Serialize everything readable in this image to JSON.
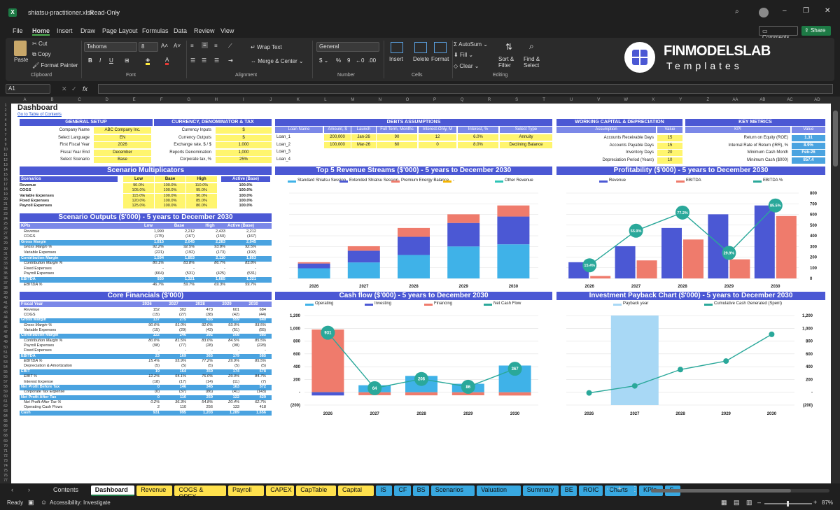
{
  "window": {
    "filename": "shiatsu-practitioner.xlsx",
    "mode": "Read-Only"
  },
  "menu": [
    "File",
    "Home",
    "Insert",
    "Draw",
    "Page Layout",
    "Formulas",
    "Data",
    "Review",
    "View"
  ],
  "top_buttons": {
    "comments": "Comments",
    "share": "Share"
  },
  "ribbon": {
    "paste": "Paste",
    "cut": "Cut",
    "copy": "Copy",
    "format_painter": "Format Painter",
    "clipboard": "Clipboard",
    "font_name": "Tahoma",
    "font_size": "8",
    "font": "Font",
    "wrap_text": "Wrap Text",
    "merge_center": "Merge & Center",
    "alignment": "Alignment",
    "number_format": "General",
    "number": "Number",
    "insert": "Insert",
    "delete": "Delete",
    "format": "Format",
    "cells": "Cells",
    "autosum": "AutoSum",
    "fill": "Fill",
    "clear": "Clear",
    "sort_filter": "Sort & Filter",
    "find_select": "Find & Select",
    "editing": "Editing"
  },
  "brand": {
    "name": "FINMODELSLAB",
    "sub": "Templates"
  },
  "formula_bar": {
    "cell_ref": "A1",
    "fx": "fx"
  },
  "columns": [
    "A",
    "B",
    "C",
    "D",
    "E",
    "F",
    "G",
    "H",
    "I",
    "J",
    "K",
    "L",
    "M",
    "N",
    "O",
    "P",
    "Q",
    "R",
    "S",
    "T",
    "U",
    "V",
    "W",
    "X",
    "Y",
    "Z",
    "AA",
    "AB",
    "AC",
    "AD"
  ],
  "rows": [
    "1",
    "2",
    "3",
    "4",
    "5",
    "6",
    "7",
    "8",
    "9",
    "10",
    "11",
    "12",
    "13",
    "14",
    "15",
    "16",
    "17",
    "18",
    "19",
    "20",
    "21",
    "22",
    "23",
    "24",
    "25",
    "26",
    "27",
    "28",
    "29",
    "30",
    "31",
    "32",
    "33",
    "34",
    "35",
    "36",
    "37",
    "38",
    "39",
    "40",
    "41",
    "42",
    "43",
    "44",
    "45",
    "46",
    "47",
    "48",
    "49",
    "50",
    "51",
    "52",
    "53",
    "54",
    "55",
    "56",
    "57",
    "58",
    "59",
    "60",
    "61",
    "62",
    "63",
    "64",
    "65",
    "66",
    "67",
    "68",
    "69",
    "70",
    "71",
    "72",
    "73",
    "74",
    "75",
    "76",
    "77"
  ],
  "dashboard": {
    "title": "Dashboard",
    "toc_link": "Go to Table of Contents"
  },
  "general_setup": {
    "title": "GENERAL SETUP",
    "rows": [
      [
        "Company Name",
        "ABC Company Inc."
      ],
      [
        "Select Language",
        "EN"
      ],
      [
        "First Fiscal Year",
        "2026"
      ],
      [
        "Fiscal Year End",
        "December"
      ],
      [
        "Select Scenario",
        "Base"
      ]
    ]
  },
  "currency": {
    "title": "CURRENCY, DENOMINATOR & TAX",
    "rows": [
      [
        "Currency Inputs",
        "$"
      ],
      [
        "Currency Outputs",
        "$"
      ],
      [
        "Exchange rate, $ / $",
        "1.000"
      ],
      [
        "Reports Denomination",
        "1,000"
      ],
      [
        "Corporate tax, %",
        "25%"
      ]
    ]
  },
  "debts": {
    "title": "DEBTS ASSUMPTIONS",
    "headers": [
      "Loan Name",
      "Amount, $",
      "Launch",
      "Full Term, Months",
      "Interest-Only, M",
      "Interest, %",
      "Select Type"
    ],
    "rows": [
      [
        "Loan_1",
        "200,000",
        "Jan-26",
        "90",
        "12",
        "6.0%",
        "Annuity"
      ],
      [
        "Loan_2",
        "100,000",
        "Mar-26",
        "60",
        "0",
        "8.0%",
        "Declining Balance"
      ],
      [
        "Loan_3",
        "",
        "",
        "",
        "",
        "",
        ""
      ],
      [
        "Loan_4",
        "",
        "",
        "",
        "",
        "",
        ""
      ]
    ]
  },
  "working_capital": {
    "title": "WORKING CAPITAL & DEPRECIATION",
    "headers": [
      "Assumption",
      "Value"
    ],
    "rows": [
      [
        "Accounts Receivable Days",
        "15"
      ],
      [
        "Accounts Payable Days",
        "15"
      ],
      [
        "Inventory Days",
        "20"
      ],
      [
        "Depreciation Period (Years)",
        "10"
      ]
    ]
  },
  "key_metrics": {
    "title": "KEY METRICS",
    "headers": [
      "KPI",
      "Value"
    ],
    "rows": [
      [
        "Return on Equity (ROE)",
        "1.31"
      ],
      [
        "Internal Rate of Return (IRR), %",
        "8.9%"
      ],
      [
        "Minimum Cash Month",
        "Feb-26"
      ],
      [
        "Minimum Cash ($000)",
        "857.4"
      ]
    ]
  },
  "scenario_mult": {
    "title": "Scenario Multiplicators",
    "headers": [
      "Scenarios",
      "Low",
      "Base",
      "High",
      "Active (Base)"
    ],
    "rows": [
      [
        "Revenue",
        "90.0%",
        "100.0%",
        "110.0%",
        "100.0%"
      ],
      [
        "COGS",
        "105.0%",
        "100.0%",
        "95.0%",
        "100.0%"
      ],
      [
        "Variable Expenses",
        "115.0%",
        "100.0%",
        "90.0%",
        "100.0%"
      ],
      [
        "Fixed Expenses",
        "120.0%",
        "100.0%",
        "85.0%",
        "100.0%"
      ],
      [
        "Payroll Expenses",
        "125.0%",
        "100.0%",
        "80.0%",
        "100.0%"
      ]
    ]
  },
  "scenario_out": {
    "title": "Scenario Outputs ($'000) - 5 years to December 2030",
    "headers": [
      "KPIs",
      "Low",
      "Base",
      "High",
      "Active (Base)"
    ],
    "rows": [
      [
        "Revenue",
        "1,990",
        "2,212",
        "2,433",
        "2,212",
        "n"
      ],
      [
        "COGS",
        "(175)",
        "(167)",
        "(150)",
        "(167)",
        "n"
      ],
      [
        "Gross Margin",
        "1,815",
        "2,045",
        "2,283",
        "2,045",
        "h"
      ],
      [
        "Gross Margin %",
        "91.2%",
        "92.5%",
        "93.8%",
        "92.5%",
        "i"
      ],
      [
        "Variable Expenses",
        "(221)",
        "(192)",
        "(173)",
        "(192)",
        "n"
      ],
      [
        "Contribution Margin",
        "1,594",
        "1,853",
        "2,110",
        "1,853",
        "h"
      ],
      [
        "Contribution Margin %",
        "80.1%",
        "83.8%",
        "86.7%",
        "83.8%",
        "i"
      ],
      [
        "Fixed Expenses",
        "-",
        "-",
        "-",
        "-",
        "n"
      ],
      [
        "Payroll Expenses",
        "(664)",
        "(531)",
        "(425)",
        "(531)",
        "n"
      ],
      [
        "EBITDA",
        "930",
        "1,321",
        "1,685",
        "1,321",
        "h"
      ],
      [
        "EBITDA %",
        "46.7%",
        "59.7%",
        "69.3%",
        "59.7%",
        "i"
      ]
    ]
  },
  "core": {
    "title": "Core Financials ($'000)",
    "headers": [
      "Fiscal Year",
      "2026",
      "2027",
      "2028",
      "2029",
      "2030"
    ],
    "rows": [
      [
        "Revenue",
        "152",
        "302",
        "473",
        "601",
        "684",
        "n"
      ],
      [
        "COGS",
        "(15)",
        "(27)",
        "(38)",
        "(42)",
        "(44)",
        "n"
      ],
      [
        "Gross Margin",
        "137",
        "275",
        "435",
        "559",
        "640",
        "h"
      ],
      [
        "Gross Margin %",
        "90.0%",
        "91.0%",
        "92.0%",
        "93.0%",
        "93.5%",
        "i"
      ],
      [
        "Variable Expenses",
        "(15)",
        "(29)",
        "(43)",
        "(51)",
        "(55)",
        "n"
      ],
      [
        "Contribution Margin",
        "122",
        "246",
        "392",
        "508",
        "585",
        "h"
      ],
      [
        "Contribution Margin %",
        "80.0%",
        "81.5%",
        "83.0%",
        "84.5%",
        "85.5%",
        "i"
      ],
      [
        "Payroll Expenses",
        "(98)",
        "(77)",
        "(28)",
        "(98)",
        "(228)",
        "n"
      ],
      [
        "Fixed Expenses",
        "-",
        "-",
        "-",
        "-",
        "-",
        "n"
      ],
      [
        "EBITDA",
        "23",
        "169",
        "365",
        "179",
        "585",
        "h"
      ],
      [
        "EBITDA %",
        "15.4%",
        "55.9%",
        "77.2%",
        "29.9%",
        "85.5%",
        "i"
      ],
      [
        "Depreciation & Amortization",
        "(5)",
        "(5)",
        "(5)",
        "(5)",
        "(5)",
        "n"
      ],
      [
        "EBIT",
        "19",
        "164",
        "359",
        "174",
        "578",
        "h"
      ],
      [
        "EBIT %",
        "12.2%",
        "54.1%",
        "76.0%",
        "29.0%",
        "84.7%",
        "i"
      ],
      [
        "Interest Expense",
        "(18)",
        "(17)",
        "(14)",
        "(11)",
        "(7)",
        "n"
      ],
      [
        "Net Profit Before Tax",
        "0",
        "146",
        "345",
        "163",
        "572",
        "h"
      ],
      [
        "Corporate Tax Expense",
        "(0)",
        "(37)",
        "(86)",
        "(41)",
        "(143)",
        "n"
      ],
      [
        "Net Profit After Tax",
        "0",
        "110",
        "259",
        "122",
        "429",
        "h"
      ],
      [
        "Net Profit After Tax %",
        "0.2%",
        "36.3%",
        "54.8%",
        "20.4%",
        "62.7%",
        "i"
      ],
      [
        "Operating Cash Flows",
        "2",
        "110",
        "256",
        "133",
        "418",
        "n"
      ],
      [
        "Cash",
        "931",
        "995",
        "1,203",
        "1,289",
        "1,656",
        "h"
      ]
    ]
  },
  "chart_data": [
    {
      "type": "bar",
      "id": "revenue_streams",
      "title": "Top 5 Revenue Streams ($'000) - 5 years to December 2030",
      "categories": [
        "2026",
        "2027",
        "2028",
        "2029",
        "2030"
      ],
      "stacked": true,
      "series": [
        {
          "name": "Standard Shiatsu Session",
          "color": "#3fb2e8",
          "values": [
            95,
            150,
            220,
            300,
            320
          ]
        },
        {
          "name": "Extended Shiatsu Session",
          "color": "#4b58d4",
          "values": [
            45,
            110,
            170,
            220,
            260
          ]
        },
        {
          "name": "Premium Energy Balance",
          "color": "#ef7b6c",
          "values": [
            12,
            42,
            83,
            81,
            104
          ]
        },
        {
          "name": "-",
          "color": "#f4b400",
          "values": [
            0,
            0,
            0,
            0,
            0
          ]
        },
        {
          "name": "Other Revenue",
          "color": "#2ec4b6",
          "values": [
            0,
            0,
            0,
            0,
            0
          ]
        }
      ],
      "ylim": [
        0,
        800
      ]
    },
    {
      "type": "bar",
      "id": "profitability",
      "title": "Profitability ($'000) - 5 years to December 2030",
      "categories": [
        "2026",
        "2027",
        "2028",
        "2029",
        "2030"
      ],
      "series": [
        {
          "name": "Revenue",
          "color": "#4b58d4",
          "values": [
            152,
            302,
            473,
            601,
            684
          ]
        },
        {
          "name": "EBITDA",
          "color": "#ef7b6c",
          "values": [
            23,
            169,
            365,
            179,
            585
          ]
        },
        {
          "name": "EBITDA %",
          "color": "#2aa89a",
          "values": [
            15.4,
            55.9,
            77.2,
            29.9,
            85.5
          ],
          "labels": [
            "15.4%",
            "55.9%",
            "77.2%",
            "29.9%",
            "85.5%"
          ],
          "axis": "right"
        }
      ],
      "ylim": [
        0,
        800
      ],
      "y2lim": [
        0,
        100
      ],
      "yticks": [
        "0",
        "100",
        "200",
        "300",
        "400",
        "500",
        "600",
        "700",
        "800"
      ]
    },
    {
      "type": "bar",
      "id": "cash_flow",
      "title": "Cash flow ($'000) - 5 years to December 2030",
      "categories": [
        "2026",
        "2027",
        "2028",
        "2029",
        "2030"
      ],
      "stacked": true,
      "series": [
        {
          "name": "Operating",
          "color": "#3fb2e8",
          "values": [
            2,
            110,
            256,
            133,
            418
          ]
        },
        {
          "name": "Investing",
          "color": "#4b58d4",
          "values": [
            -50,
            0,
            0,
            0,
            0
          ]
        },
        {
          "name": "Financing",
          "color": "#ef7b6c",
          "values": [
            979,
            -46,
            -48,
            -47,
            -51
          ]
        },
        {
          "name": "Net Cash Flow",
          "color": "#2aa89a",
          "values": [
            931,
            64,
            208,
            86,
            367
          ],
          "labels": [
            "931",
            "64",
            "208",
            "86",
            "367"
          ]
        }
      ],
      "ylim": [
        -200,
        1200
      ],
      "yticks": [
        "(200)",
        "-",
        "200",
        "400",
        "600",
        "800",
        "1,000",
        "1,200"
      ]
    },
    {
      "type": "line",
      "id": "payback",
      "title": "Investment Payback Chart ($'000) - 5 years to December 2030",
      "categories": [
        "2026",
        "2027",
        "2028",
        "2029",
        "2030"
      ],
      "series": [
        {
          "name": "Payback year",
          "color": "#a8d8f5",
          "values": [
            0,
            1,
            0,
            0,
            0
          ]
        },
        {
          "name": "Cumulative Cash Generated (Spent)",
          "color": "#2aa89a",
          "values": [
            -10,
            100,
            355,
            488,
            906
          ]
        }
      ],
      "ylim": [
        -200,
        1200
      ],
      "yticks": [
        "(200)",
        "-",
        "200",
        "400",
        "600",
        "800",
        "1,000",
        "1,200"
      ]
    }
  ],
  "sheet_tabs": [
    {
      "label": "Contents",
      "bg": "#1f1f1f",
      "fg": "#ddd"
    },
    {
      "label": "Dashboard",
      "bg": "#ffffff",
      "fg": "#111"
    },
    {
      "label": "Revenue",
      "bg": "#ffe14d",
      "fg": "#111"
    },
    {
      "label": "COGS & OPEX",
      "bg": "#ffe14d",
      "fg": "#111"
    },
    {
      "label": "Payroll",
      "bg": "#ffe14d",
      "fg": "#111"
    },
    {
      "label": "CAPEX",
      "bg": "#ffe14d",
      "fg": "#111"
    },
    {
      "label": "CapTable",
      "bg": "#ffe14d",
      "fg": "#111"
    },
    {
      "label": "Capital",
      "bg": "#ffe14d",
      "fg": "#111"
    },
    {
      "label": "IS",
      "bg": "#38a8e0",
      "fg": "#111"
    },
    {
      "label": "CF",
      "bg": "#38a8e0",
      "fg": "#111"
    },
    {
      "label": "BS",
      "bg": "#38a8e0",
      "fg": "#111"
    },
    {
      "label": "Scenarios",
      "bg": "#38a8e0",
      "fg": "#111"
    },
    {
      "label": "Valuation",
      "bg": "#38a8e0",
      "fg": "#111"
    },
    {
      "label": "Summary",
      "bg": "#38a8e0",
      "fg": "#111"
    },
    {
      "label": "BE",
      "bg": "#38a8e0",
      "fg": "#111"
    },
    {
      "label": "ROIC",
      "bg": "#38a8e0",
      "fg": "#111"
    },
    {
      "label": "Charts",
      "bg": "#38a8e0",
      "fg": "#111"
    },
    {
      "label": "KPIs",
      "bg": "#38a8e0",
      "fg": "#111"
    },
    {
      "label": "S",
      "bg": "#38a8e0",
      "fg": "#111"
    }
  ],
  "status": {
    "ready": "Ready",
    "accessibility": "Accessibility: Investigate",
    "zoom": "87%"
  }
}
